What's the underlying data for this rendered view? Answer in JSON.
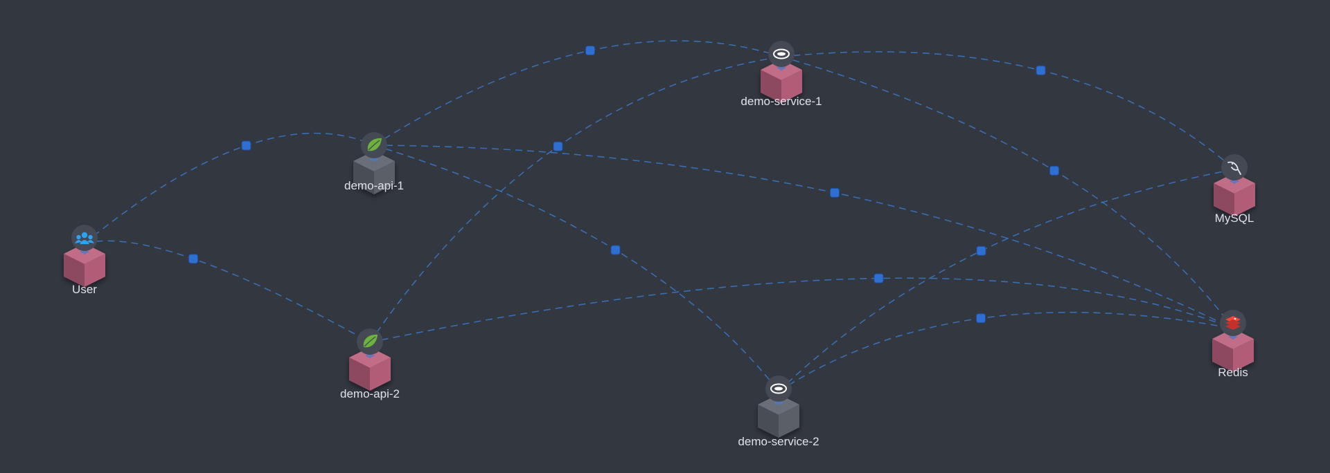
{
  "topology": {
    "colors": {
      "background": "#333740",
      "edge": "#3a78c8",
      "handle": "#2f6fd1",
      "cube_active": "#b5607a",
      "cube_inactive": "#5b5f69",
      "badge": "#444953"
    },
    "nodes": [
      {
        "id": "user",
        "label": "User",
        "icon": "users-icon",
        "status": "active"
      },
      {
        "id": "demo-api-1",
        "label": "demo-api-1",
        "icon": "spring-leaf-icon",
        "status": "inactive"
      },
      {
        "id": "demo-api-2",
        "label": "demo-api-2",
        "icon": "spring-leaf-icon",
        "status": "active"
      },
      {
        "id": "demo-service-1",
        "label": "demo-service-1",
        "icon": "service-bean-icon",
        "status": "active"
      },
      {
        "id": "demo-service-2",
        "label": "demo-service-2",
        "icon": "service-bean-icon",
        "status": "inactive"
      },
      {
        "id": "mysql",
        "label": "MySQL",
        "icon": "mysql-dolphin-icon",
        "status": "active"
      },
      {
        "id": "redis",
        "label": "Redis",
        "icon": "redis-stack-icon",
        "status": "active"
      }
    ],
    "edges": [
      {
        "from": "user",
        "to": "demo-api-1"
      },
      {
        "from": "user",
        "to": "demo-api-2"
      },
      {
        "from": "demo-api-1",
        "to": "demo-service-1"
      },
      {
        "from": "demo-api-1",
        "to": "demo-service-2"
      },
      {
        "from": "demo-api-1",
        "to": "redis"
      },
      {
        "from": "demo-api-2",
        "to": "demo-service-1"
      },
      {
        "from": "demo-api-2",
        "to": "redis"
      },
      {
        "from": "demo-service-1",
        "to": "mysql"
      },
      {
        "from": "demo-service-1",
        "to": "redis"
      },
      {
        "from": "demo-service-2",
        "to": "mysql"
      },
      {
        "from": "demo-service-2",
        "to": "redis"
      }
    ]
  }
}
